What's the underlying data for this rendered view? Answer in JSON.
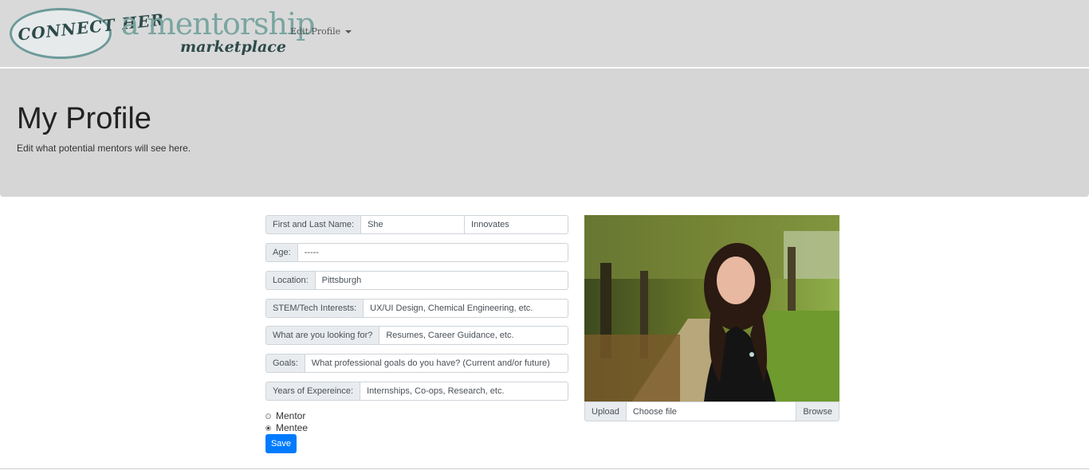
{
  "navbar": {
    "logo_connect": "CONNECT HER",
    "logo_tagline": "a mentorship",
    "logo_sub": "marketplace",
    "menu_label": "Edit Profile"
  },
  "header": {
    "title": "My Profile",
    "subtitle": "Edit what potential mentors will see here."
  },
  "form": {
    "name": {
      "label": "First and Last Name:",
      "first": "She",
      "last": "Innovates"
    },
    "age": {
      "label": "Age:",
      "value": "-----"
    },
    "location": {
      "label": "Location:",
      "value": "Pittsburgh"
    },
    "interests": {
      "label": "STEM/Tech Interests:",
      "value": "UX/UI Design, Chemical Engineering, etc."
    },
    "looking": {
      "label": "What are you looking for?",
      "value": "Resumes, Career Guidance, etc."
    },
    "goals": {
      "label": "Goals:",
      "value": "What professional goals do you have? (Current and/or future)"
    },
    "experience": {
      "label": "Years of Expereince:",
      "value": "Internships, Co-ops, Research, etc."
    },
    "role_options": [
      {
        "label": "Mentor",
        "selected": false
      },
      {
        "label": "Mentee",
        "selected": true
      }
    ],
    "save_label": "Save"
  },
  "photo": {
    "upload_label": "Upload",
    "file_placeholder": "Choose file",
    "browse_label": "Browse"
  }
}
